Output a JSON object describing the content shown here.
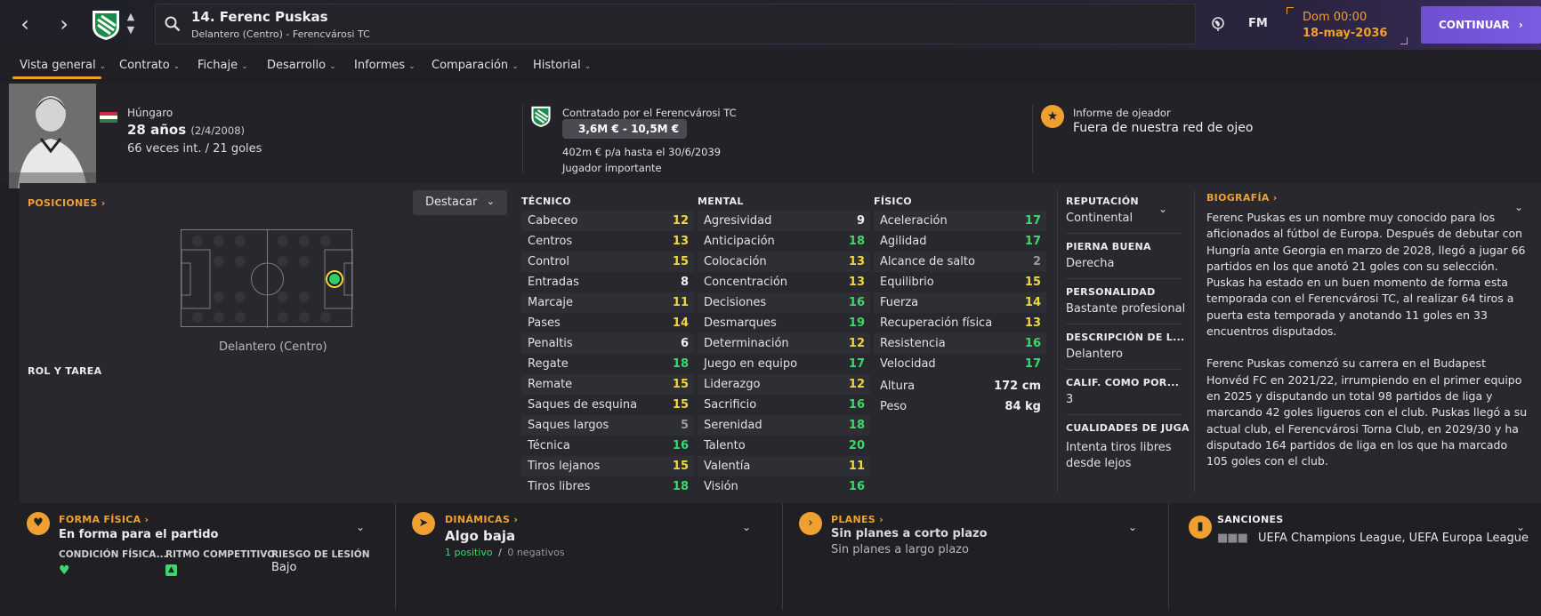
{
  "header": {
    "back_glyph": "‹",
    "forward_glyph": "›",
    "player_title": "14. Ferenc Puskas",
    "player_subtitle": "Delantero (Centro) - Ferencvárosi TC",
    "fm_label": "FM",
    "date_day": "Dom 00:00",
    "date_date": "18-may-2036",
    "continue_label": "CONTINUAR"
  },
  "tabs": [
    {
      "label": "Vista general"
    },
    {
      "label": "Contrato"
    },
    {
      "label": "Fichaje"
    },
    {
      "label": "Desarrollo"
    },
    {
      "label": "Informes"
    },
    {
      "label": "Comparación"
    },
    {
      "label": "Historial"
    }
  ],
  "info": {
    "nationality": "Húngaro",
    "age": "28 años",
    "dob": "(2/4/2008)",
    "caps": "66 veces int. / 21 goles",
    "contracted_by": "Contratado por el Ferencvárosi TC",
    "value_range": "3,6M € - 10,5M €",
    "wage": "402m € p/a hasta el 30/6/2039",
    "squad_status": "Jugador importante",
    "scout_title": "Informe de ojeador",
    "scout_text": "Fuera de nuestra red de ojeo"
  },
  "positions": {
    "title": "POSICIONES ›",
    "highlight_button": "Destacar",
    "position_label": "Delantero (Centro)",
    "role_title": "ROL Y TAREA"
  },
  "attributes": {
    "technical_title": "TÉCNICO",
    "mental_title": "MENTAL",
    "physical_title": "FÍSICO",
    "technical": [
      {
        "name": "Cabeceo",
        "value": "12"
      },
      {
        "name": "Centros",
        "value": "13"
      },
      {
        "name": "Control",
        "value": "15"
      },
      {
        "name": "Entradas",
        "value": "8"
      },
      {
        "name": "Marcaje",
        "value": "11"
      },
      {
        "name": "Pases",
        "value": "14"
      },
      {
        "name": "Penaltis",
        "value": "6"
      },
      {
        "name": "Regate",
        "value": "18"
      },
      {
        "name": "Remate",
        "value": "15"
      },
      {
        "name": "Saques de esquina",
        "value": "15"
      },
      {
        "name": "Saques largos",
        "value": "5"
      },
      {
        "name": "Técnica",
        "value": "16"
      },
      {
        "name": "Tiros lejanos",
        "value": "15"
      },
      {
        "name": "Tiros libres",
        "value": "18"
      }
    ],
    "mental": [
      {
        "name": "Agresividad",
        "value": "9"
      },
      {
        "name": "Anticipación",
        "value": "18"
      },
      {
        "name": "Colocación",
        "value": "13"
      },
      {
        "name": "Concentración",
        "value": "13"
      },
      {
        "name": "Decisiones",
        "value": "16"
      },
      {
        "name": "Desmarques",
        "value": "19"
      },
      {
        "name": "Determinación",
        "value": "12"
      },
      {
        "name": "Juego en equipo",
        "value": "17"
      },
      {
        "name": "Liderazgo",
        "value": "12"
      },
      {
        "name": "Sacrificio",
        "value": "16"
      },
      {
        "name": "Serenidad",
        "value": "18"
      },
      {
        "name": "Talento",
        "value": "20"
      },
      {
        "name": "Valentía",
        "value": "11"
      },
      {
        "name": "Visión",
        "value": "16"
      }
    ],
    "physical": [
      {
        "name": "Aceleración",
        "value": "17"
      },
      {
        "name": "Agilidad",
        "value": "17"
      },
      {
        "name": "Alcance de salto",
        "value": "2"
      },
      {
        "name": "Equilibrio",
        "value": "15"
      },
      {
        "name": "Fuerza",
        "value": "14"
      },
      {
        "name": "Recuperación física",
        "value": "13"
      },
      {
        "name": "Resistencia",
        "value": "16"
      },
      {
        "name": "Velocidad",
        "value": "17"
      }
    ],
    "height_label": "Altura",
    "height_value": "172 cm",
    "weight_label": "Peso",
    "weight_value": "84 kg"
  },
  "profile": [
    {
      "title": "REPUTACIÓN",
      "value": "Continental"
    },
    {
      "title": "PIERNA BUENA",
      "value": "Derecha"
    },
    {
      "title": "PERSONALIDAD",
      "value": "Bastante profesional"
    },
    {
      "title": "DESCRIPCIÓN DE L...",
      "value": "Delantero"
    },
    {
      "title": "CALIF. COMO POR...",
      "value": "3"
    },
    {
      "title": "CUALIDADES DE JUGA",
      "value": "Intenta tiros libres desde lejos"
    }
  ],
  "bio": {
    "title": "BIOGRAFÍA ›",
    "p1": "Ferenc Puskas es un nombre muy conocido para los aficionados al fútbol de Europa. Después de debutar con Hungría ante Georgia en marzo de 2028, llegó a jugar 66 partidos en los que anotó 21 goles con su selección. Puskas ha estado en un buen momento de forma esta temporada con el Ferencvárosi TC, al realizar 64 tiros a puerta esta temporada y anotando 11 goles en 33 encuentros disputados.",
    "p2": "Ferenc Puskas comenzó su carrera en el Budapest Honvéd FC en 2021/22, irrumpiendo en el primer equipo en 2025 y disputando un total 98 partidos de liga y marcando 42 goles ligueros con el club. Puskas llegó a su actual club, el Ferencvárosi Torna Club, en 2029/30 y ha disputado 164 partidos de liga en los que ha marcado 105 goles con el club."
  },
  "bottom": {
    "fitness_title": "FORMA FÍSICA ›",
    "fitness_value": "En forma para el partido",
    "condition_label": "CONDICIÓN FÍSICA...",
    "match_sharpness_label": "RITMO COMPETITIVO",
    "injury_risk_label": "RIESGO DE LESIÓN",
    "injury_risk_value": "Bajo",
    "dynamics_title": "DINÁMICAS ›",
    "dynamics_value": "Algo baja",
    "positives": "1 positivo",
    "divider": "/",
    "negatives": "0 negativos",
    "plans_title": "PLANES ›",
    "plans_short": "Sin planes a corto plazo",
    "plans_long": "Sin planes a largo plazo",
    "sanctions_title": "SANCIONES",
    "sanctions_text": "UEFA Champions League, UEFA Europa League"
  },
  "colors": {
    "accent": "#f0a030",
    "attr_green": "#3cd96a",
    "attr_yellow": "#f2d640",
    "attr_white": "#f0f0f0",
    "attr_grey": "#9a9a9a",
    "continue": "#7457d9"
  }
}
